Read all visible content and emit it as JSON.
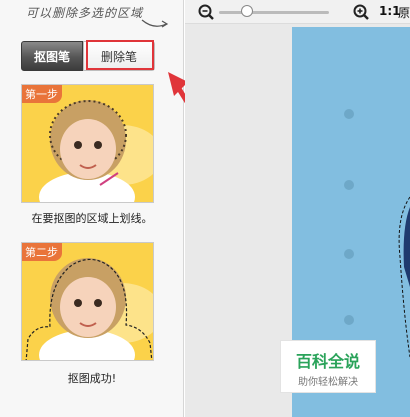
{
  "hint": "可以删除多选的区域",
  "tabs": {
    "matting_pen": "抠图笔",
    "delete_pen": "删除笔"
  },
  "steps": [
    {
      "badge": "第一步",
      "caption": "在要抠图的区域上划线。"
    },
    {
      "badge": "第二步",
      "caption": "抠图成功!"
    }
  ],
  "toolbar": {
    "ratio": "1:1",
    "ratio_suffix": "原"
  },
  "watermark": {
    "title": "百科全说",
    "subtitle": "助你轻松解决"
  },
  "colors": {
    "highlight": "#e0353a",
    "badge": "#e9743a",
    "watermark_green": "#2aa35a"
  }
}
